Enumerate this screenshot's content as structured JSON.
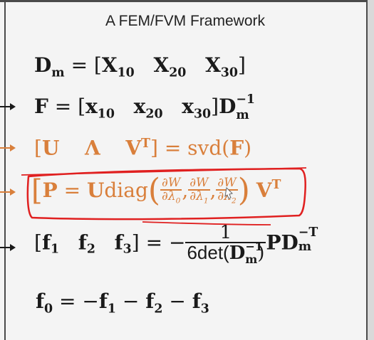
{
  "title": "A FEM/FVM Framework",
  "eq1": {
    "lhs": "D",
    "lhs_sub": "m",
    "eq": "= [",
    "x1": "X",
    "x1_sub": "10",
    "x2": "X",
    "x2_sub": "20",
    "x3": "X",
    "x3_sub": "30",
    "close": "]"
  },
  "eq2": {
    "lhs": "F",
    "eq": "= [",
    "x1": "x",
    "x1_sub": "10",
    "x2": "x",
    "x2_sub": "20",
    "x3": "x",
    "x3_sub": "30",
    "close": "]",
    "d": "D",
    "d_sub": "m",
    "d_sup": "−1"
  },
  "eq3": {
    "open": "[",
    "u": "U",
    "lam": "Λ",
    "v": "V",
    "v_sup": "T",
    "close": "]",
    "rhs": "= svd(",
    "f": "F",
    "rp": ")"
  },
  "eq4": {
    "p": "P",
    "eq": "= ",
    "u": "U",
    "diag": "diag",
    "d1_num": "∂W",
    "d1_den": "∂λ",
    "d1_sub": "0",
    "d2_num": "∂W",
    "d2_den": "∂λ",
    "d2_sub": "1",
    "d3_num": "∂W",
    "d3_den": "∂λ",
    "d3_sub": "2",
    "comma": ",",
    "v": "V",
    "v_sup": "T"
  },
  "eq5": {
    "open": "[",
    "f1": "f",
    "f1_sub": "1",
    "f2": "f",
    "f2_sub": "2",
    "f3": "f",
    "f3_sub": "3",
    "close": "]",
    "eq": "= −",
    "num": "1",
    "den_a": "6det(",
    "den_d": "D",
    "den_d_sub": "m",
    "den_d_sup": "−1",
    "den_b": ")",
    "p": "P",
    "d": "D",
    "d_sub": "m",
    "d_sup": "−T"
  },
  "eq6": {
    "f0": "f",
    "f0_sub": "0",
    "rhs": "= −",
    "f1": "f",
    "f1_sub": "1",
    "minus1": " − ",
    "f2": "f",
    "f2_sub": "2",
    "minus2": " − ",
    "f3": "f",
    "f3_sub": "3"
  },
  "colors": {
    "background": "#f4f4f4",
    "text": "#1a1a1a",
    "highlight": "#d97f3b",
    "annotation": "#e02020"
  }
}
